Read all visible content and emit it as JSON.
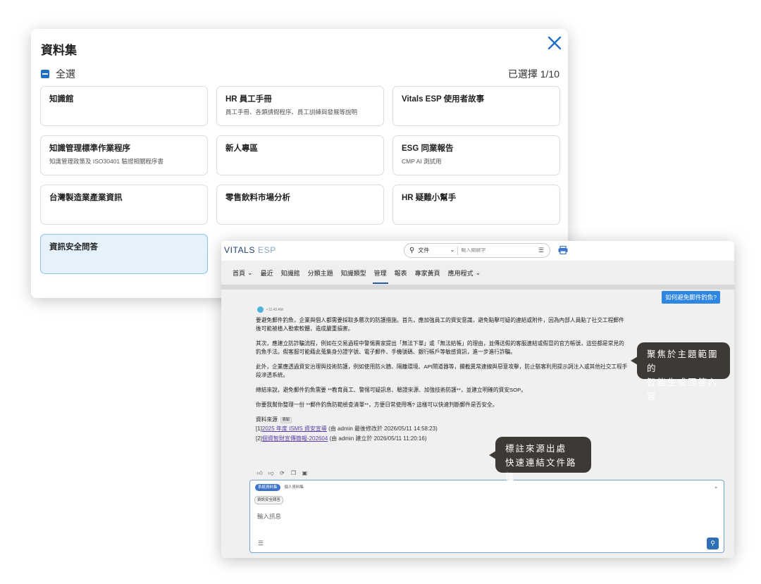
{
  "modal": {
    "title": "資料集",
    "select_all_label": "全選",
    "selected_count": "已選擇 1/10",
    "datasets": [
      {
        "title": "知識館",
        "desc": "",
        "selected": false
      },
      {
        "title": "HR 員工手冊",
        "desc": "員工手冊、各類請假程序、員工訓練與發展等說明",
        "selected": false
      },
      {
        "title": "Vitals ESP 使用者故事",
        "desc": "",
        "selected": false
      },
      {
        "title": "知識管理標準作業程序",
        "desc": "知識管理政策及 ISO30401 驗證相關程序書",
        "selected": false
      },
      {
        "title": "新人專區",
        "desc": "",
        "selected": false
      },
      {
        "title": "ESG 同業報告",
        "desc": "CMP AI 測試用",
        "selected": false
      },
      {
        "title": "台灣製造業產業資訊",
        "desc": "",
        "selected": false
      },
      {
        "title": "零售飲料市場分析",
        "desc": "",
        "selected": false
      },
      {
        "title": "HR 疑難小幫手",
        "desc": "",
        "selected": false
      },
      {
        "title": "資訊安全問答",
        "desc": "",
        "selected": true
      }
    ]
  },
  "app": {
    "logo_main": "VITALS",
    "logo_sub": " ESP",
    "search": {
      "scope": "文件",
      "placeholder": "輸入關鍵字"
    },
    "nav": [
      {
        "label": "首頁",
        "dropdown": true,
        "active": false
      },
      {
        "label": "最近",
        "dropdown": false,
        "active": false
      },
      {
        "label": "知識館",
        "dropdown": false,
        "active": false
      },
      {
        "label": "分類主題",
        "dropdown": false,
        "active": false
      },
      {
        "label": "知識類型",
        "dropdown": false,
        "active": false
      },
      {
        "label": "管理",
        "dropdown": false,
        "active": true
      },
      {
        "label": "報表",
        "dropdown": false,
        "active": false
      },
      {
        "label": "專家黃頁",
        "dropdown": false,
        "active": false
      },
      {
        "label": "應用程式",
        "dropdown": true,
        "active": false
      }
    ],
    "chat": {
      "question": "如何避免郵件釣魚?",
      "time": "• 11:43 AM",
      "answer_paragraphs": [
        "要避免郵件釣魚，企業與個人都需要採取多層次的防護措施。首先，應加強員工的資安意識，避免點擊可疑的連結或附件，因為內部人員點了社交工程郵件後可能被植入勒索軟體，造成嚴重損害。",
        "其次，應建立防詐騙流程，例如在交易過程中警惕賣家提出「無法下單」或「無法結帳」的理由，並傳送假的客服連結或假冒的官方帳號，這些都是常見的釣魚手法。假客服可能藉此蒐集身分證字號、電子郵件、手機號碼、銀行帳戶等敏感資訊，進一步進行詐騙。",
        "此外，企業應透過資安治理與技術防護，例如使用防火牆、隔離環境、API閘道器等，攔截異常連線與惡意攻擊，防止駭客利用提示詞注入或其他社交工程手段滲透系統。",
        "總結來說，避免郵件釣魚需要 **教育員工、警惕可疑訊息、驗證來源、加強技術防護**，並建立明確的資安SOP。",
        "你要我幫你整理一份 **郵件釣魚防範檢查清單**，方便日常使用嗎? 這樣可以快速判斷郵件是否安全。"
      ],
      "sources_title": "資料來源",
      "sources_tag": "展開",
      "sources": [
        {
          "num": "[1]",
          "link": "2025 年度 ISMS 資安宣導",
          "meta": " (由 admin 最後修改於 2026/05/11 14:58:23)"
        },
        {
          "num": "[2]",
          "link": "個資智財宣傳簡報-202604",
          "meta": " (由 admin 建立於 2026/05/11 11:20:16)"
        }
      ],
      "feedback_icons": [
        "thumbs-up-icon",
        "thumbs-down-icon",
        "regenerate-icon",
        "copy-icon",
        "ai-icon"
      ]
    },
    "composer": {
      "tab_active": "系統資料集",
      "tab_inactive": "個人資料集",
      "selected_dataset": "資訊安全問答",
      "placeholder": "輸入訊息"
    }
  },
  "callouts": {
    "first": [
      "聚焦於主題範圍的",
      "智能生成回答內容"
    ],
    "second": [
      "標註來源出處",
      "快速連結文件路徑"
    ]
  },
  "colors": {
    "accent": "#1f6fc9",
    "selected_card_bg": "#e6f2fb",
    "callout_bg": "#3d3934",
    "link": "#5b3ea8"
  }
}
